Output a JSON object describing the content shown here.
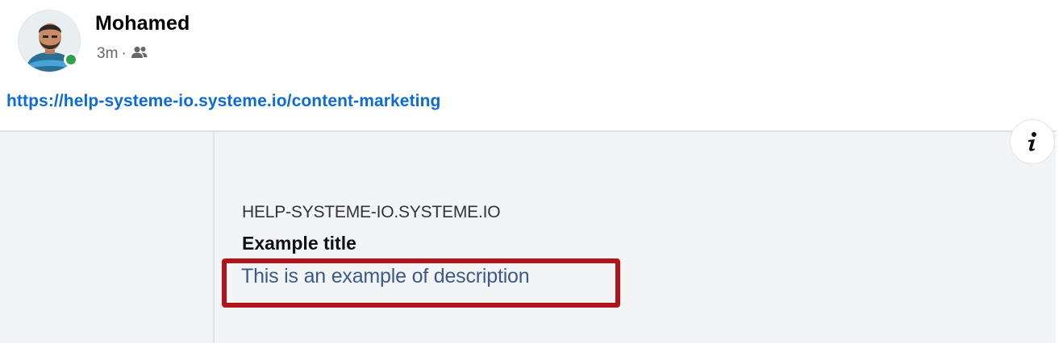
{
  "post": {
    "author": {
      "name": "Mohamed",
      "online": true,
      "avatar_icon": "user-avatar",
      "status_color": "#31a24c"
    },
    "meta": {
      "time": "3m",
      "separator": "·",
      "audience_icon": "friends-icon"
    },
    "link": {
      "text": "https://help-systeme-io.systeme.io/content-marketing",
      "color": "#0d6ad6"
    },
    "preview": {
      "domain": "HELP-SYSTEME-IO.SYSTEME.IO",
      "title": "Example title",
      "description": "This is an example of description",
      "info_icon": "info-icon",
      "highlight_color": "#b3141c"
    }
  }
}
